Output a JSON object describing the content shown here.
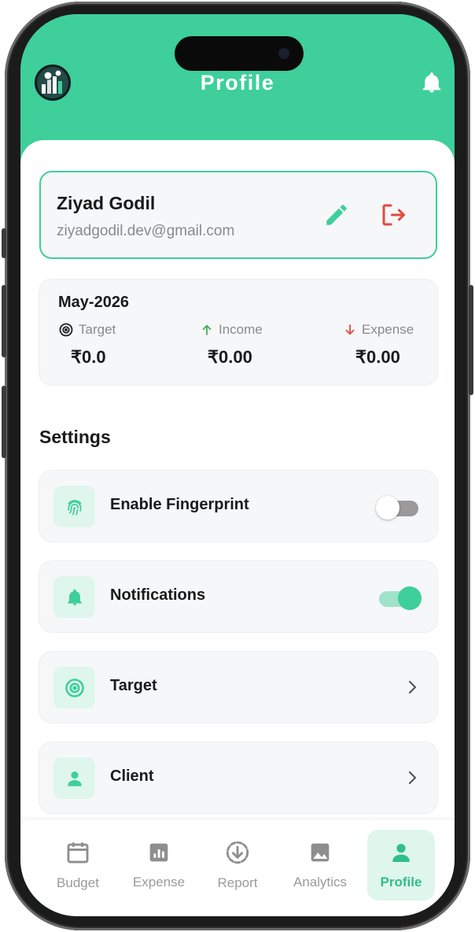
{
  "header": {
    "title": "Profile",
    "logo_icon": "app-logo-icon",
    "bell_icon": "bell-icon"
  },
  "profile": {
    "name": "Ziyad Godil",
    "email": "ziyadgodil.dev@gmail.com",
    "edit_icon": "pencil-icon",
    "logout_icon": "logout-icon"
  },
  "summary": {
    "month": "May-2026",
    "target": {
      "label": "Target",
      "value": "₹0.0",
      "icon": "target-icon"
    },
    "income": {
      "label": "Income",
      "value": "₹0.00",
      "icon": "arrow-up-icon"
    },
    "expense": {
      "label": "Expense",
      "value": "₹0.00",
      "icon": "arrow-down-icon"
    }
  },
  "settings": {
    "title": "Settings",
    "items": [
      {
        "label": "Enable Fingerprint",
        "icon": "fingerprint-icon",
        "control": "toggle",
        "enabled": false
      },
      {
        "label": "Notifications",
        "icon": "bell-icon",
        "control": "toggle",
        "enabled": true
      },
      {
        "label": "Target",
        "icon": "target-icon",
        "control": "chevron"
      },
      {
        "label": "Client",
        "icon": "person-icon",
        "control": "chevron"
      }
    ]
  },
  "nav": {
    "items": [
      {
        "label": "Budget",
        "icon": "calendar-icon",
        "active": false
      },
      {
        "label": "Expense",
        "icon": "bar-chart-icon",
        "active": false
      },
      {
        "label": "Report",
        "icon": "download-circle-icon",
        "active": false
      },
      {
        "label": "Analytics",
        "icon": "image-icon",
        "active": false
      },
      {
        "label": "Profile",
        "icon": "person-icon",
        "active": true
      }
    ]
  },
  "colors": {
    "accent": "#3ecf9a",
    "danger": "#e04a3f",
    "income": "#3fae5a",
    "expense": "#e04a3f"
  }
}
